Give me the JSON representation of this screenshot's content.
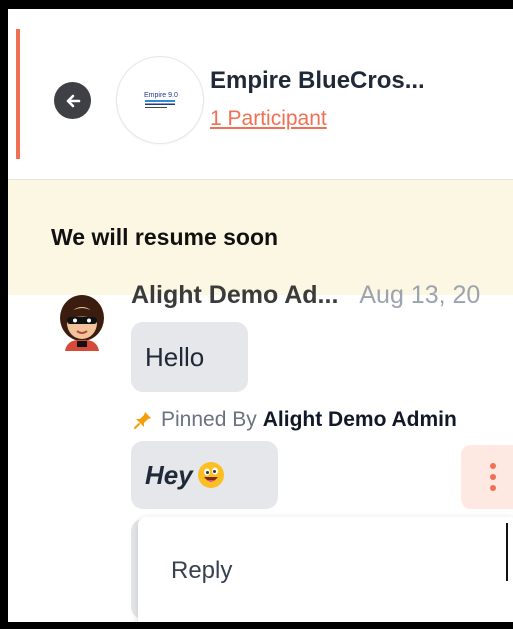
{
  "header": {
    "title": "Empire BlueCros...",
    "participants": "1 Participant",
    "logo_text": "Empire 9.0"
  },
  "banner": {
    "text": "We will resume soon"
  },
  "message": {
    "sender": "Alight Demo Ad...",
    "time": "Aug 13, 20",
    "text1": "Hello",
    "pin_label": "Pinned By",
    "pinned_by": "Alight Demo Admin",
    "text2": "Hey"
  },
  "context_menu": {
    "reply": "Reply"
  },
  "colors": {
    "accent": "#ef7052",
    "banner_bg": "#fbf7e2",
    "bubble_bg": "#e5e7eb",
    "pin": "#f59e0b"
  },
  "icons": [
    "back-arrow-icon",
    "pin-icon",
    "grinning-face-emoji-icon",
    "more-vertical-icon"
  ]
}
